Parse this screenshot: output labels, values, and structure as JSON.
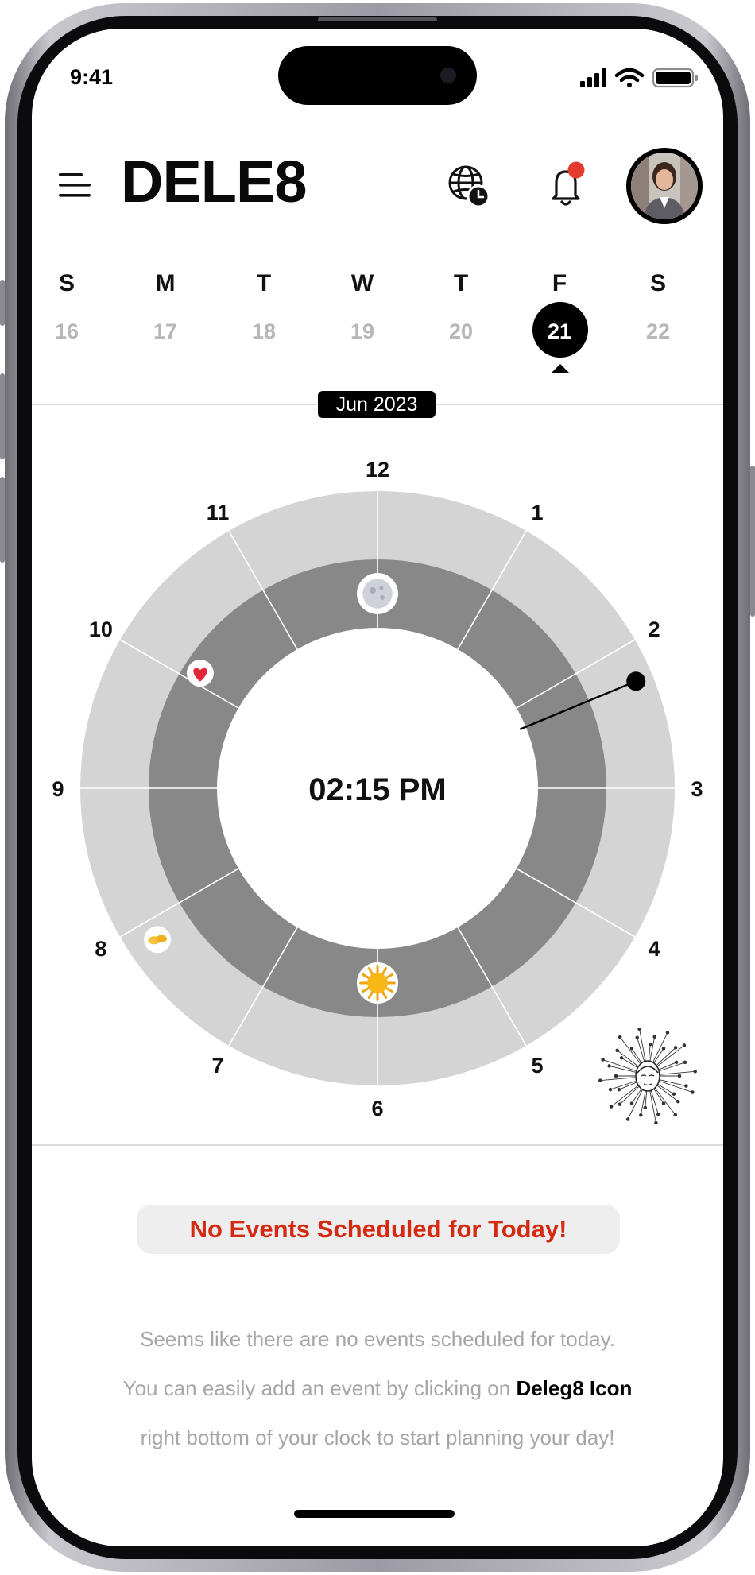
{
  "status_bar": {
    "time": "9:41"
  },
  "header": {
    "menu_icon": "menu-icon",
    "brand": "DELE8",
    "globe_icon": "globe-clock-icon",
    "bell_icon": "notification-bell-icon",
    "notification_dot_color": "#e53a2f",
    "avatar": "user-avatar"
  },
  "week": {
    "days": [
      {
        "letter": "S",
        "date": "16"
      },
      {
        "letter": "M",
        "date": "17"
      },
      {
        "letter": "T",
        "date": "18"
      },
      {
        "letter": "W",
        "date": "19"
      },
      {
        "letter": "T",
        "date": "20"
      },
      {
        "letter": "F",
        "date": "21",
        "selected": true
      },
      {
        "letter": "S",
        "date": "22"
      }
    ]
  },
  "month_label": "Jun 2023",
  "clock": {
    "center_time": "02:15 PM",
    "hour_labels": [
      "12",
      "1",
      "2",
      "3",
      "4",
      "5",
      "6",
      "7",
      "8",
      "9",
      "10",
      "11"
    ],
    "hand_time_hours": 2.25,
    "markers": [
      {
        "icon": "moon-icon",
        "hour": 0
      },
      {
        "icon": "heart-icon",
        "hour": 10
      },
      {
        "icon": "sun-icon",
        "hour": 6
      },
      {
        "icon": "handshake-icon",
        "hour": 8
      }
    ],
    "colors": {
      "outer_ring": "#d4d4d4",
      "inner_ring": "#888888",
      "divider": "#ffffff"
    }
  },
  "deleg8_icon": "deleg8-network-face-icon",
  "empty_state": {
    "title": "No Events Scheduled for Today!",
    "line1": "Seems like there are no events scheduled for today.",
    "line2_prefix": "You can easily add an event by clicking on ",
    "line2_bold": "Deleg8 Icon",
    "line3": "right bottom of your clock to start planning your day!",
    "title_color": "#d42a12"
  }
}
